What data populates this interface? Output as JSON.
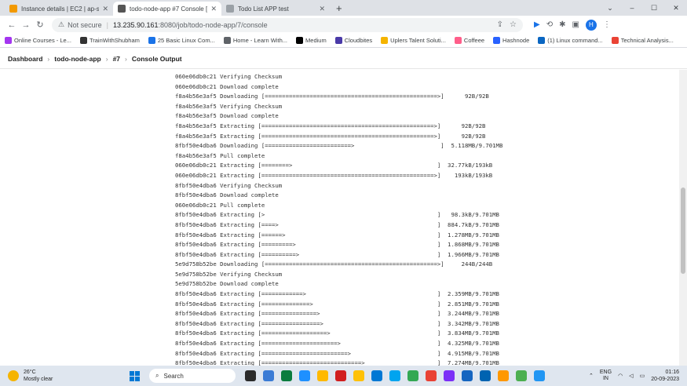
{
  "tabs": [
    {
      "title": "Instance details | EC2 | ap-south",
      "color": "#f29900",
      "active": false
    },
    {
      "title": "todo-node-app #7 Console [Jen",
      "color": "#555555",
      "active": true
    },
    {
      "title": "Todo List APP test",
      "color": "#9aa0a6",
      "active": false
    }
  ],
  "address": {
    "not_secure": "Not secure",
    "host": "13.235.90.161",
    "path": ":8080/job/todo-node-app/7/console"
  },
  "bookmarks": [
    {
      "label": "Online Courses - Le...",
      "color": "#a435f0"
    },
    {
      "label": "TrainWithShubham",
      "color": "#333333"
    },
    {
      "label": "25 Basic Linux Com...",
      "color": "#1a73e8"
    },
    {
      "label": "Home - Learn With...",
      "color": "#5f6368"
    },
    {
      "label": "Medium",
      "color": "#000000"
    },
    {
      "label": "Cloudbites",
      "color": "#4a3aa8"
    },
    {
      "label": "Uplers Talent Soluti...",
      "color": "#f5b400"
    },
    {
      "label": "Coffeee",
      "color": "#ff5e8a"
    },
    {
      "label": "Hashnode",
      "color": "#2962ff"
    },
    {
      "label": "(1) Linux command...",
      "color": "#0a66c2"
    },
    {
      "label": "Technical Analysis...",
      "color": "#ea4335"
    }
  ],
  "breadcrumb": [
    "Dashboard",
    "todo-node-app",
    "#7",
    "Console Output"
  ],
  "console_lines": [
    "060e06db0c21 Verifying Checksum",
    "060e06db0c21 Download complete",
    "f8a4b56e3af5 Downloading [==================================================>]      92B/92B",
    "f8a4b56e3af5 Verifying Checksum",
    "f8a4b56e3af5 Download complete",
    "f8a4b56e3af5 Extracting [==================================================>]      92B/92B",
    "f8a4b56e3af5 Extracting [==================================================>]      92B/92B",
    "8fbf50e4dba6 Downloading [=========================>                         ]  5.118MB/9.701MB",
    "f8a4b56e3af5 Pull complete",
    "060e06db0c21 Extracting [========>                                          ]  32.77kB/193kB",
    "060e06db0c21 Extracting [==================================================>]    193kB/193kB",
    "8fbf50e4dba6 Verifying Checksum",
    "8fbf50e4dba6 Download complete",
    "060e06db0c21 Pull complete",
    "8fbf50e4dba6 Extracting [>                                                  ]   98.3kB/9.701MB",
    "8fbf50e4dba6 Extracting [====>                                              ]  884.7kB/9.701MB",
    "8fbf50e4dba6 Extracting [======>                                            ]  1.278MB/9.701MB",
    "8fbf50e4dba6 Extracting [=========>                                         ]  1.868MB/9.701MB",
    "8fbf50e4dba6 Extracting [==========>                                        ]  1.966MB/9.701MB",
    "5e9d758b52be Downloading [==================================================>]     244B/244B",
    "5e9d758b52be Verifying Checksum",
    "5e9d758b52be Download complete",
    "8fbf50e4dba6 Extracting [============>                                      ]  2.359MB/9.701MB",
    "8fbf50e4dba6 Extracting [==============>                                    ]  2.851MB/9.701MB",
    "8fbf50e4dba6 Extracting [================>                                  ]  3.244MB/9.701MB",
    "8fbf50e4dba6 Extracting [=================>                                 ]  3.342MB/9.701MB",
    "8fbf50e4dba6 Extracting [===================>                               ]  3.834MB/9.701MB",
    "8fbf50e4dba6 Extracting [======================>                            ]  4.325MB/9.701MB",
    "8fbf50e4dba6 Extracting [=========================>                         ]  4.915MB/9.701MB",
    "8fbf50e4dba6 Extracting [=============================>                     ]  7.274MB/9.701MB"
  ],
  "taskbar": {
    "temp": "26°C",
    "weather": "Mostly clear",
    "search": "Search",
    "lang1": "ENG",
    "lang2": "IN",
    "time": "01:16",
    "date": "20-09-2023",
    "apps": [
      "#2b2b2b",
      "#3a7bd5",
      "#0a7c3e",
      "#1e90ff",
      "#ffb900",
      "#d11f1f",
      "#ffc107",
      "#0078d4",
      "#00a4ef",
      "#34a853",
      "#e94235",
      "#7b2ff7",
      "#1565c0",
      "#0063b1",
      "#ff9800",
      "#4caf50",
      "#2196f3"
    ]
  }
}
